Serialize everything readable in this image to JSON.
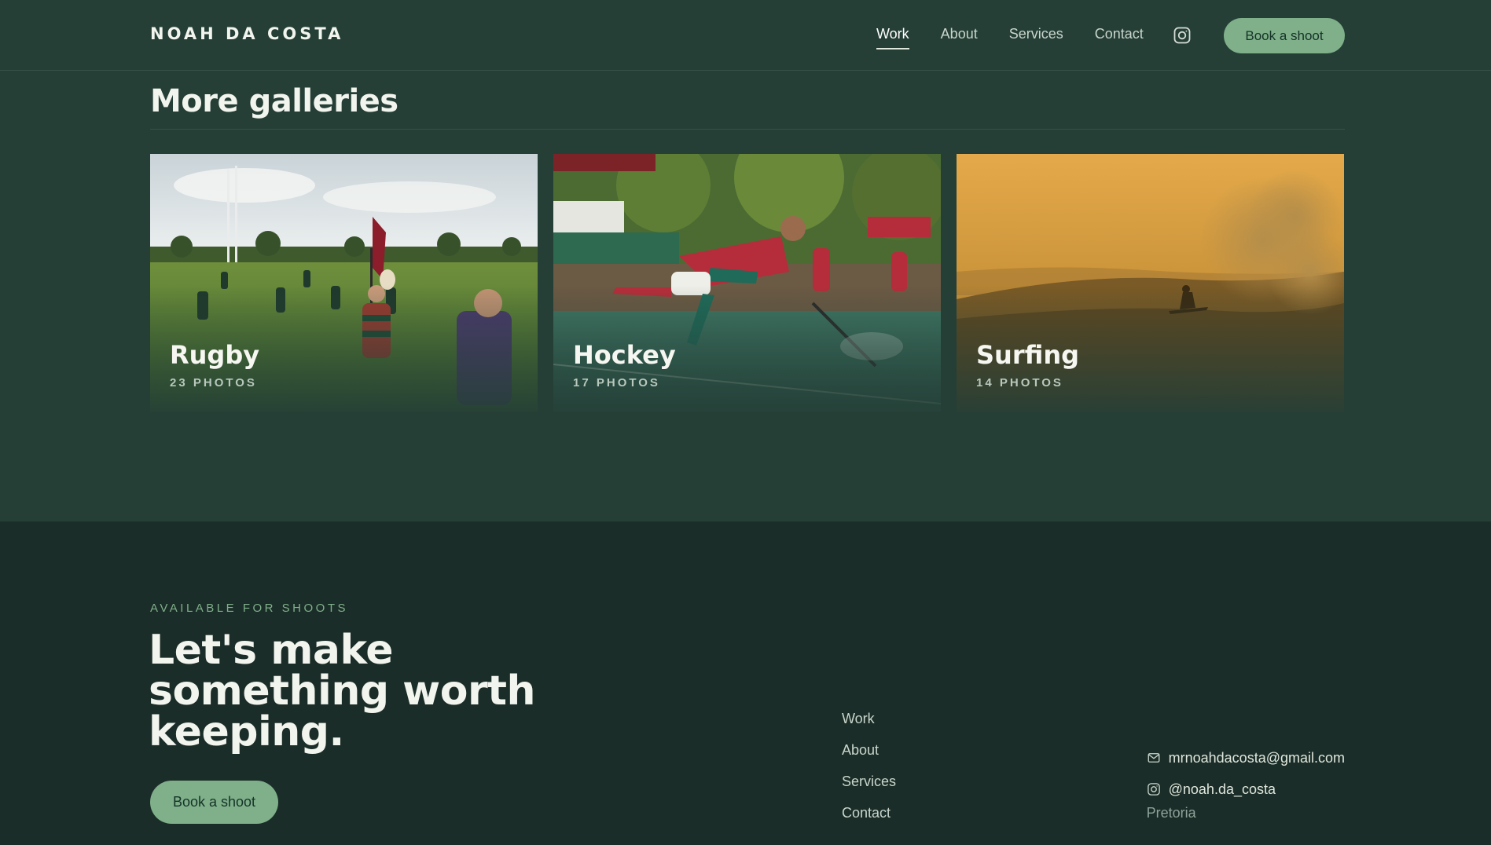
{
  "header": {
    "brand": "NOAH DA COSTA",
    "nav": [
      {
        "label": "Work",
        "active": true
      },
      {
        "label": "About",
        "active": false
      },
      {
        "label": "Services",
        "active": false
      },
      {
        "label": "Contact",
        "active": false
      }
    ],
    "instagram_icon": "instagram-icon",
    "cta_label": "Book a shoot"
  },
  "galleries": {
    "title": "More galleries",
    "cards": [
      {
        "name": "Rugby",
        "count": "23 PHOTOS",
        "image": "rugby-players-on-field"
      },
      {
        "name": "Hockey",
        "count": "17 PHOTOS",
        "image": "hockey-player-diving"
      },
      {
        "name": "Surfing",
        "count": "14 PHOTOS",
        "image": "surfer-at-sunset"
      }
    ]
  },
  "footer": {
    "eyebrow": "AVAILABLE FOR SHOOTS",
    "headline": "Let's make something worth keeping.",
    "cta_label": "Book a shoot",
    "links": [
      "Work",
      "About",
      "Services",
      "Contact"
    ],
    "contact": {
      "email": "mrnoahdacosta@gmail.com",
      "instagram": "@noah.da_costa",
      "city": "Pretoria"
    }
  },
  "colors": {
    "background": "#253f37",
    "footer_background": "#1b2d28",
    "accent": "#7fb08a",
    "text": "#f2f4ee"
  }
}
